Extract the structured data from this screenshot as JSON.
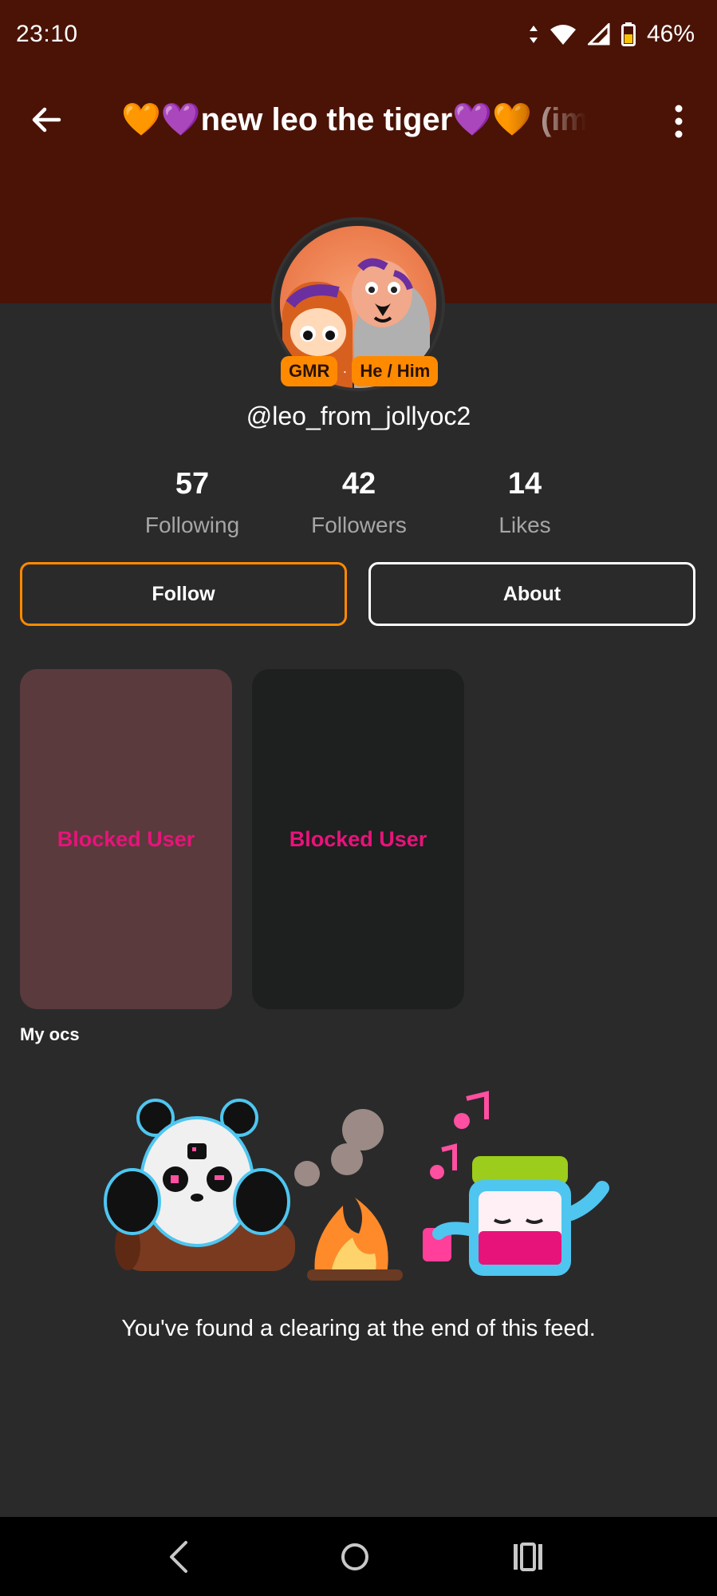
{
  "status_bar": {
    "time": "23:10",
    "battery": "46%"
  },
  "header": {
    "title": "🧡💜new leo the tiger💜🧡 (imported)"
  },
  "profile": {
    "badges": [
      "GMR",
      "He / Him"
    ],
    "username": "@leo_from_jollyoc2"
  },
  "stats": [
    {
      "value": "57",
      "label": "Following"
    },
    {
      "value": "42",
      "label": "Followers"
    },
    {
      "value": "14",
      "label": "Likes"
    }
  ],
  "actions": {
    "follow_label": "Follow",
    "about_label": "About"
  },
  "feed": {
    "cards": [
      {
        "label": "Blocked User"
      },
      {
        "label": "Blocked User"
      }
    ],
    "section_label": "My ocs",
    "end_message": "You've found a clearing at the end of this feed."
  },
  "colors": {
    "header_bg": "#4a1306",
    "accent_orange": "#ff8a00",
    "blocked_text": "#e8137a"
  }
}
